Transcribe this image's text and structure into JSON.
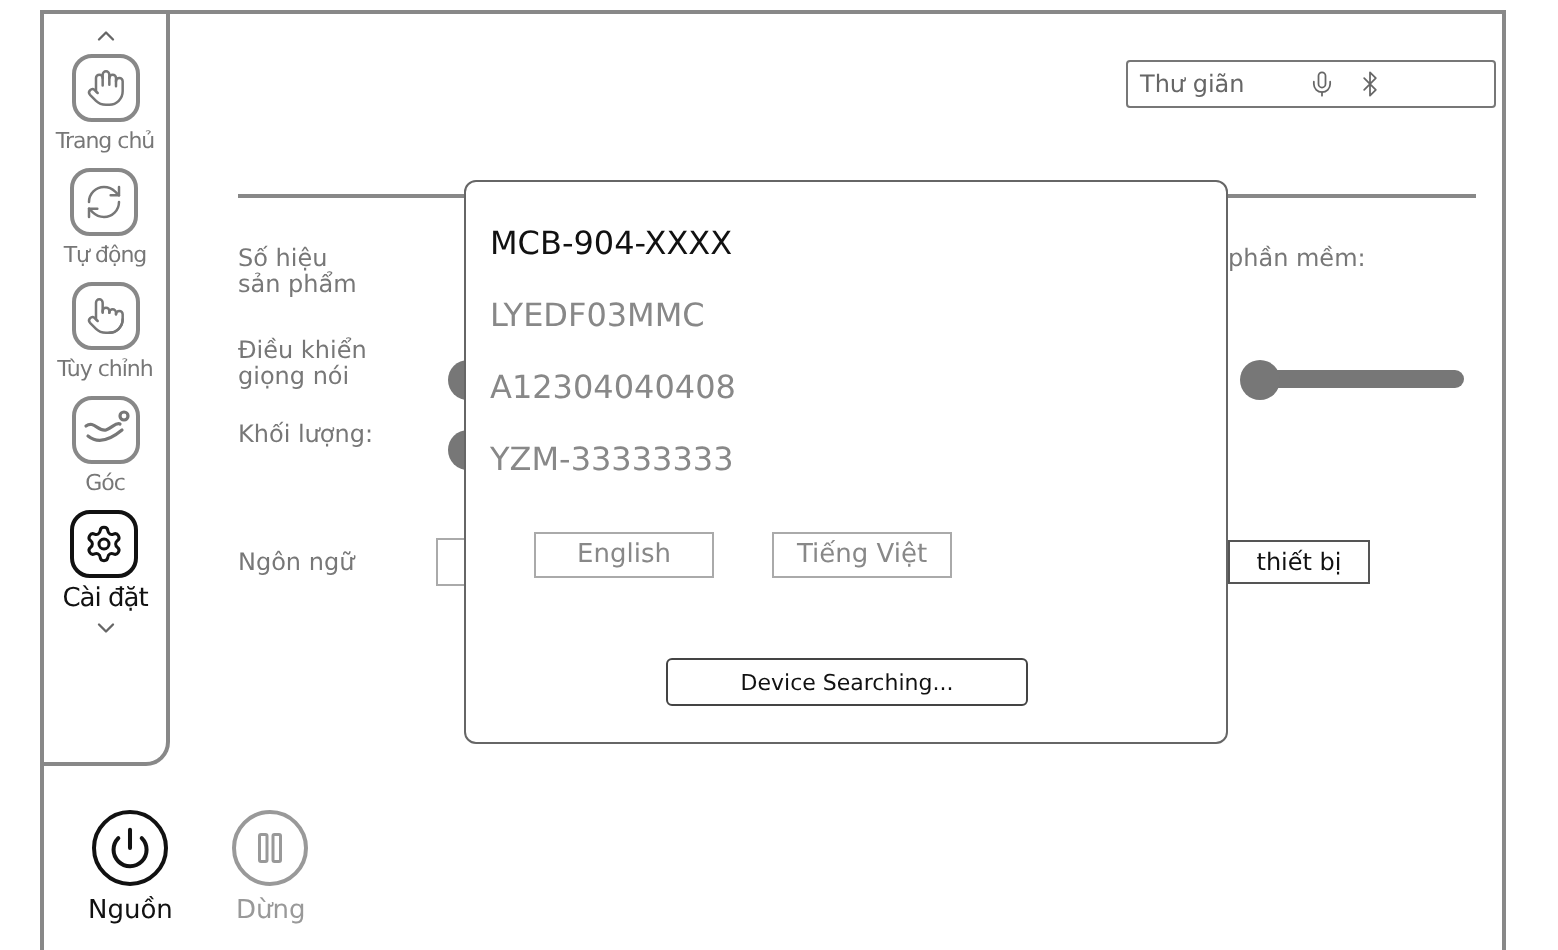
{
  "sidebar": {
    "items": [
      {
        "label": "Trang chủ",
        "selected": false
      },
      {
        "label": "Tự động",
        "selected": false
      },
      {
        "label": "Tùy chỉnh",
        "selected": false
      },
      {
        "label": "Góc",
        "selected": false
      },
      {
        "label": "Cài đặt",
        "selected": true
      }
    ]
  },
  "controls": [
    {
      "label": "Nguồn",
      "kind": "power",
      "active": true
    },
    {
      "label": "Dừng",
      "kind": "pause",
      "active": false
    }
  ],
  "status": {
    "mode": "Thư giãn"
  },
  "settings": {
    "labels": [
      "Số hiệu\nsản phẩm",
      "Điều khiển\ngiọng nói",
      "Khối lượng:",
      "Ngôn ngữ"
    ],
    "software_label": "phần mềm:",
    "software_slider": {
      "level": 0
    },
    "device_button": "thiết bị"
  },
  "dialog": {
    "model": "MCB-904-XXXX",
    "lines": [
      "LYEDF03MMC",
      "A12304040408",
      "YZM-33333333"
    ],
    "languages": [
      "English",
      "Tiếng Việt"
    ],
    "button": "Device Searching..."
  }
}
